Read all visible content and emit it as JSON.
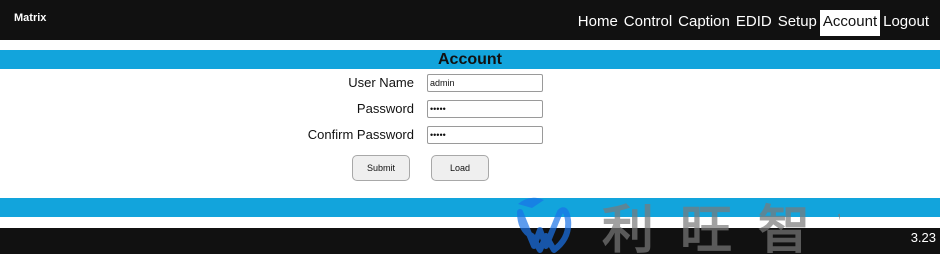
{
  "app": {
    "brand": "Matrix",
    "version": "3.23"
  },
  "nav": {
    "items": [
      {
        "label": "Home"
      },
      {
        "label": "Control"
      },
      {
        "label": "Caption"
      },
      {
        "label": "EDID"
      },
      {
        "label": "Setup"
      },
      {
        "label": "Account",
        "active": true
      },
      {
        "label": "Logout"
      }
    ]
  },
  "page": {
    "title": "Account"
  },
  "form": {
    "username": {
      "label": "User Name",
      "value": "admin"
    },
    "password": {
      "label": "Password",
      "value": "•••••"
    },
    "confirm": {
      "label": "Confirm Password",
      "value": "•••••"
    },
    "submit_label": "Submit",
    "load_label": "Load"
  },
  "watermark": {
    "text": "利旺智能",
    "color": "#7a7a7a",
    "logo_color": "#1a73e8"
  },
  "colors": {
    "bar": "#111111",
    "accent": "#12a4dc"
  }
}
